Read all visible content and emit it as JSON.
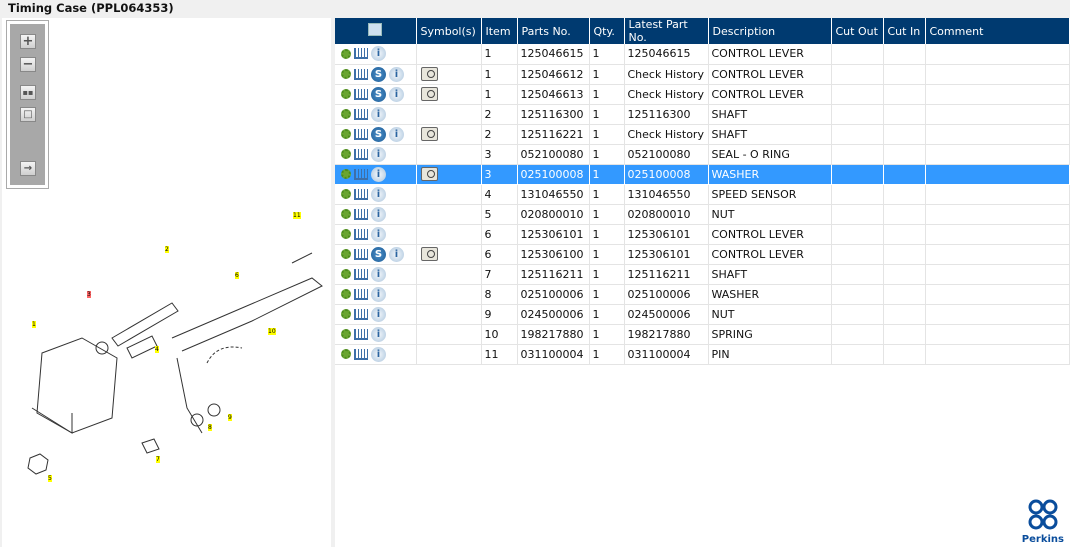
{
  "title": "Timing Case (PPL064353)",
  "toolbar": {
    "zoom_in": "+",
    "zoom_out": "−"
  },
  "diagram": {
    "callouts": [
      "1",
      "2",
      "3",
      "4",
      "5",
      "6",
      "7",
      "8",
      "9",
      "10",
      "11"
    ],
    "highlighted_callout": "3"
  },
  "table": {
    "headers": [
      "",
      "Symbol(s)",
      "Item",
      "Parts No.",
      "Qty.",
      "Latest Part No.",
      "Description",
      "Cut Out",
      "Cut In",
      "Comment"
    ],
    "rows": [
      {
        "s": false,
        "item": "1",
        "part": "125046615",
        "qty": "1",
        "latest": "125046615",
        "desc": "CONTROL LEVER"
      },
      {
        "s": true,
        "item": "1",
        "part": "125046612",
        "qty": "1",
        "latest": "Check History",
        "desc": "CONTROL LEVER"
      },
      {
        "s": true,
        "item": "1",
        "part": "125046613",
        "qty": "1",
        "latest": "Check History",
        "desc": "CONTROL LEVER"
      },
      {
        "s": false,
        "item": "2",
        "part": "125116300",
        "qty": "1",
        "latest": "125116300",
        "desc": "SHAFT"
      },
      {
        "s": true,
        "item": "2",
        "part": "125116221",
        "qty": "1",
        "latest": "Check History",
        "desc": "SHAFT"
      },
      {
        "s": false,
        "item": "3",
        "part": "052100080",
        "qty": "1",
        "latest": "052100080",
        "desc": "SEAL - O RING"
      },
      {
        "s": false,
        "book": true,
        "selected": true,
        "item": "3",
        "part": "025100008",
        "qty": "1",
        "latest": "025100008",
        "desc": "WASHER"
      },
      {
        "s": false,
        "item": "4",
        "part": "131046550",
        "qty": "1",
        "latest": "131046550",
        "desc": "SPEED SENSOR"
      },
      {
        "s": false,
        "item": "5",
        "part": "020800010",
        "qty": "1",
        "latest": "020800010",
        "desc": "NUT"
      },
      {
        "s": false,
        "item": "6",
        "part": "125306101",
        "qty": "1",
        "latest": "125306101",
        "desc": "CONTROL LEVER"
      },
      {
        "s": true,
        "item": "6",
        "part": "125306100",
        "qty": "1",
        "latest": "125306101",
        "desc": "CONTROL LEVER"
      },
      {
        "s": false,
        "item": "7",
        "part": "125116211",
        "qty": "1",
        "latest": "125116211",
        "desc": "SHAFT"
      },
      {
        "s": false,
        "item": "8",
        "part": "025100006",
        "qty": "1",
        "latest": "025100006",
        "desc": "WASHER"
      },
      {
        "s": false,
        "item": "9",
        "part": "024500006",
        "qty": "1",
        "latest": "024500006",
        "desc": "NUT"
      },
      {
        "s": false,
        "item": "10",
        "part": "198217880",
        "qty": "1",
        "latest": "198217880",
        "desc": "SPRING"
      },
      {
        "s": false,
        "item": "11",
        "part": "031100004",
        "qty": "1",
        "latest": "031100004",
        "desc": "PIN"
      }
    ]
  },
  "logo": {
    "text": "Perkins"
  },
  "colors": {
    "header": "#003a70",
    "selected": "#3399ff"
  }
}
